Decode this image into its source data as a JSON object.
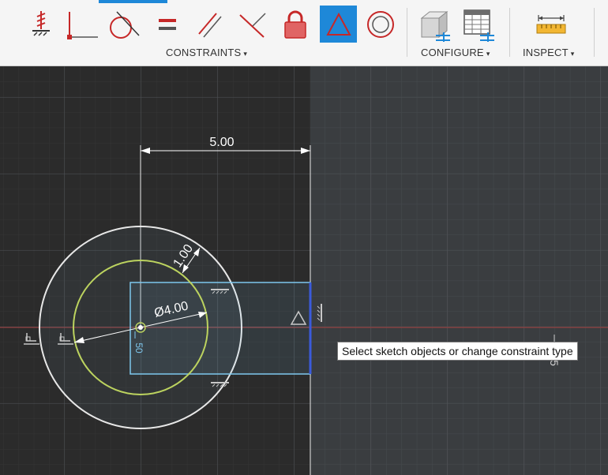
{
  "toolbar": {
    "groups": {
      "constraints": "CONSTRAINTS",
      "configure": "CONFIGURE",
      "inspect": "INSPECT"
    },
    "dropdown_caret": "▾",
    "constraint_tools": [
      "fix-icon",
      "coincident-icon",
      "tangent-icon",
      "equal-icon",
      "parallel-icon",
      "perpendicular-icon",
      "lock-icon",
      "triangle-icon",
      "concentric-icon"
    ],
    "active_tool": "triangle-icon"
  },
  "sketch": {
    "dim_width": "5.00",
    "dim_offset": "1.00",
    "dim_diameter": "Ø4.00",
    "small_label_left": "50",
    "small_label_right": "5"
  },
  "tooltip": {
    "text": "Select sketch objects or change constraint type"
  },
  "colors": {
    "canvas_left": "#2b2b2b",
    "canvas_right": "#3a3d40",
    "sketch_line": "#7ec8ee",
    "selected_line": "#3b5bdb",
    "inner_circle": "#bcd35f",
    "axis_red": "#a33a3a",
    "accent": "#1e88d8"
  }
}
